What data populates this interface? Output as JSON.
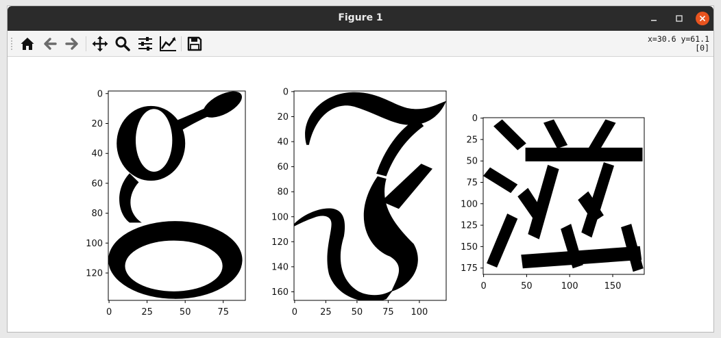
{
  "window": {
    "title": "Figure 1"
  },
  "toolbar": {
    "buttons": [
      {
        "name": "home-icon",
        "tooltip": "Home"
      },
      {
        "name": "back-arrow-icon",
        "tooltip": "Back"
      },
      {
        "name": "forward-arrow-icon",
        "tooltip": "Forward"
      },
      {
        "name": "pan-move-icon",
        "tooltip": "Pan"
      },
      {
        "name": "zoom-magnifier-icon",
        "tooltip": "Zoom"
      },
      {
        "name": "subplots-sliders-icon",
        "tooltip": "Configure subplots"
      },
      {
        "name": "axes-line-chart-icon",
        "tooltip": "Edit axes"
      },
      {
        "name": "save-floppy-icon",
        "tooltip": "Save"
      }
    ],
    "coords_line1": "x=30.6 y=61.1",
    "coords_line2": "[0]"
  },
  "colors": {
    "close": "#e9541f",
    "titlebar": "#2b2b2b",
    "ink": "#000000"
  },
  "figure": {
    "panels": [
      {
        "glyph": "g",
        "xticks": [
          "0",
          "25",
          "50",
          "75"
        ],
        "yticks": [
          "0",
          "20",
          "40",
          "60",
          "80",
          "100",
          "120"
        ]
      },
      {
        "glyph": "ℱ",
        "xticks": [
          "0",
          "25",
          "50",
          "75",
          "100"
        ],
        "yticks": [
          "0",
          "20",
          "40",
          "60",
          "80",
          "100",
          "120",
          "140",
          "160"
        ]
      },
      {
        "glyph": "滋",
        "xticks": [
          "0",
          "50",
          "100",
          "150"
        ],
        "yticks": [
          "0",
          "25",
          "50",
          "75",
          "100",
          "125",
          "150",
          "175"
        ]
      }
    ]
  }
}
